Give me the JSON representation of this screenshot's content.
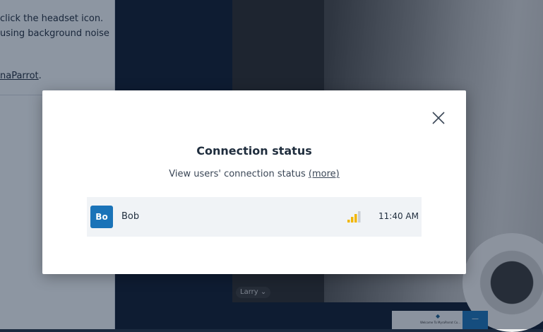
{
  "background": {
    "left_panel": {
      "lines": [
        "click the headset icon.",
        "using background noise"
      ],
      "link_text": "naParrot",
      "link_suffix": "."
    },
    "video": {
      "participant_label": "Larry ⌄",
      "thumbnail_caption": "Welcome To MyraParrot Co..."
    }
  },
  "modal": {
    "title": "Connection status",
    "subtitle": "View users' connection status",
    "more_link": "(more)",
    "users": [
      {
        "initials": "Bo",
        "name": "Bob",
        "signal_level": 0.75,
        "time": "11:40 AM"
      }
    ]
  },
  "colors": {
    "avatar": "#1a73b8",
    "signal_active": "#f2b705",
    "signal_inactive": "#c9ced4",
    "row_bg": "#f0f3f6"
  },
  "icons": {
    "close": "close-icon",
    "signal": "signal-strength-icon"
  }
}
